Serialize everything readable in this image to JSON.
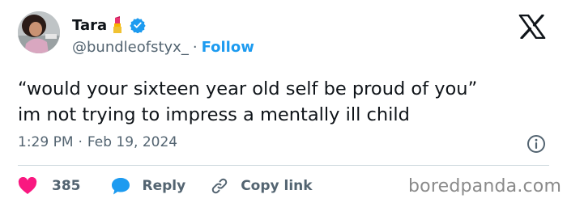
{
  "author": {
    "name": "Tara",
    "name_emoji": "lipstick-emoji",
    "verified": true,
    "handle": "@bundleofstyx_",
    "follow_label": "Follow"
  },
  "brand": {
    "logo": "x-logo-icon"
  },
  "tweet": {
    "line1": "“would your sixteen year old self be proud of you”",
    "line2": "im not trying to impress a mentally ill child",
    "time": "1:29 PM",
    "date": "Feb 19, 2024"
  },
  "actions": {
    "likes": "385",
    "reply_label": "Reply",
    "copy_label": "Copy link"
  },
  "watermark": "boredpanda.com",
  "colors": {
    "accent": "#1d9bf0",
    "heart": "#f91880",
    "text": "#0f1419",
    "muted": "#536471"
  }
}
